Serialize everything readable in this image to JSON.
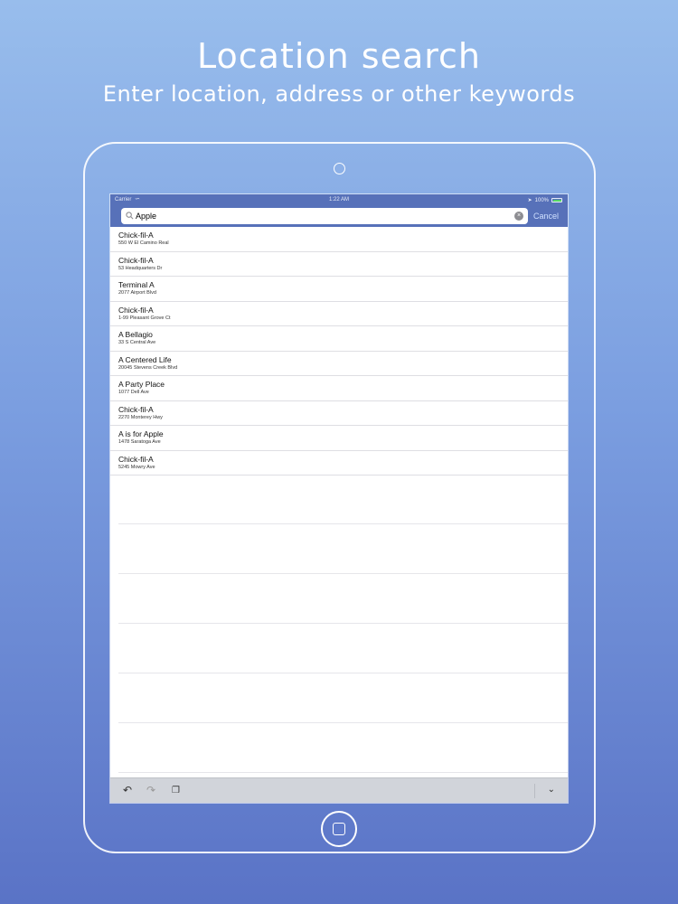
{
  "promo": {
    "title": "Location search",
    "subtitle": "Enter location, address or other keywords"
  },
  "status_bar": {
    "carrier": "Carrier",
    "time": "1:22 AM",
    "battery": "100%"
  },
  "search": {
    "value": "Apple",
    "cancel_label": "Cancel"
  },
  "results": [
    {
      "name": "Chick-fil-A",
      "address": "550 W El Camino Real"
    },
    {
      "name": "Chick-fil-A",
      "address": "53 Headquarters Dr"
    },
    {
      "name": "Terminal A",
      "address": "2077 Airport Blvd"
    },
    {
      "name": "Chick-fil-A",
      "address": "1-99 Pleasant Grove Ct"
    },
    {
      "name": "A Bellagio",
      "address": "33 S Central Ave"
    },
    {
      "name": "A Centered Life",
      "address": "20045 Stevens Creek Blvd"
    },
    {
      "name": "A Party Place",
      "address": "1077 Dell Ave"
    },
    {
      "name": "Chick-fil-A",
      "address": "2270 Monterey Hwy"
    },
    {
      "name": "A is for Apple",
      "address": "1478 Saratoga Ave"
    },
    {
      "name": "Chick-fil-A",
      "address": "5245 Mowry Ave"
    }
  ],
  "colors": {
    "nav_bar": "#5771b9",
    "battery": "#55d466"
  },
  "icons": {
    "search": "search-icon",
    "clear": "clear-icon",
    "undo": "undo-icon",
    "redo": "redo-icon",
    "paste": "paste-icon",
    "dismiss_keyboard": "chevron-down-icon"
  }
}
